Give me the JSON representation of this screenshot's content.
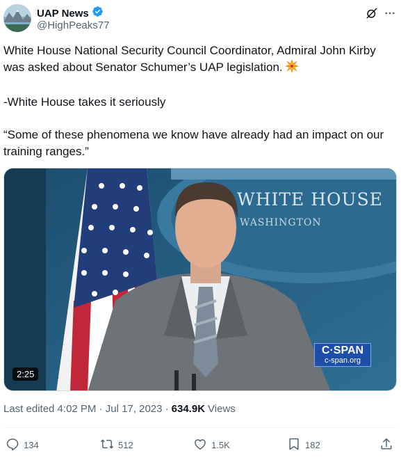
{
  "author": {
    "display_name": "UAP News",
    "handle": "@HighPeaks77",
    "verified": true,
    "avatar_icon": "mountain-landscape-avatar"
  },
  "tweet": {
    "line1": "White House National Security Council Coordinator, Admiral John Kirby was asked about Senator Schumer’s UAP legislation.",
    "emoji": "collision-emoji",
    "line2": "-White House takes it seriously",
    "line3": "“Some of these phenomena we know have already had an impact on our training ranges.”"
  },
  "media": {
    "duration": "2:25",
    "backdrop_line1": "WHITE HOUSE",
    "backdrop_line2": "WASHINGTON",
    "watermark_top": "C·SPAN",
    "watermark_bottom": "c-span.org"
  },
  "meta": {
    "edited": "Last edited 4:02 PM · Jul 17, 2023 ·",
    "views_count": "634.9K",
    "views_label": "Views"
  },
  "actions": {
    "replies": "134",
    "reposts": "512",
    "likes": "1.5K",
    "bookmarks": "182"
  },
  "colors": {
    "verified": "#1d9bf0",
    "secondary_text": "#536471",
    "primary_text": "#0f1419"
  }
}
